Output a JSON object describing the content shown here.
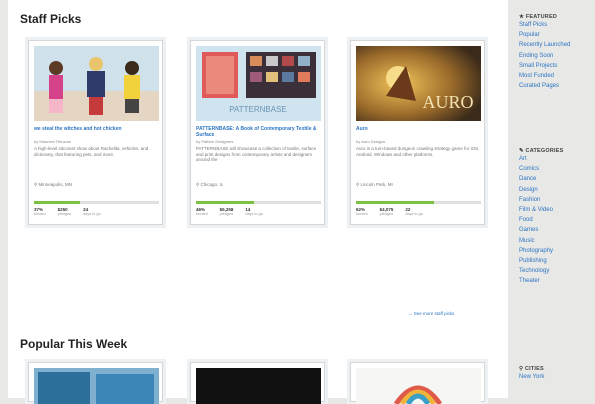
{
  "staff_picks": {
    "heading": "Staff Picks",
    "cards": [
      {
        "title": "we steal the witches and hot chicken",
        "by": "by Maureen Renzoni",
        "blurb": "A high-level sitcomet show about Rachelita, vehicles, and dictionary, that featuring pets, and more.",
        "location": "Minneapolis, MN",
        "funded_pct": 0.37,
        "stats": [
          {
            "v": "37%",
            "l": "funded"
          },
          {
            "v": "$250",
            "l": "pledged"
          },
          {
            "v": "24",
            "l": "days to go"
          }
        ]
      },
      {
        "title": "PATTERNBASE: A Book of Contemporary Textile & Surface",
        "by": "by Pattern Designers",
        "blurb": "PATTERNBASE will showcase a collection of textile, surface and print designs from contemporary artists and designers around the",
        "location": "Chicago, IL",
        "funded_pct": 0.46,
        "stats": [
          {
            "v": "46%",
            "l": "funded"
          },
          {
            "v": "$5,258",
            "l": "pledged"
          },
          {
            "v": "14",
            "l": "days to go"
          }
        ]
      },
      {
        "title": "Auro",
        "by": "by Auro Designs",
        "blurb": "Auro is a turn-based dungeon crawling strategy game for iOS, Android, Windows and other platforms.",
        "location": "Lincoln Park, MI",
        "funded_pct": 0.62,
        "stats": [
          {
            "v": "62%",
            "l": "funded"
          },
          {
            "v": "$4,075",
            "l": "pledged"
          },
          {
            "v": "22",
            "l": "days to go"
          }
        ]
      }
    ],
    "see_more": "→ See more staff picks"
  },
  "popular": {
    "heading": "Popular This Week"
  },
  "sidebar": {
    "featured_heading": "★ FEATURED",
    "featured": [
      "Staff Picks",
      "Popular",
      "Recently Launched",
      "Ending Soon",
      "Small Projects",
      "Most Funded",
      "Curated Pages"
    ],
    "categories_heading": "CATEGORIES",
    "categories": [
      "Art",
      "Comics",
      "Dance",
      "Design",
      "Fashion",
      "Film & Video",
      "Food",
      "Games",
      "Music",
      "Photography",
      "Publishing",
      "Technology",
      "Theater"
    ],
    "cities_heading": "CITIES",
    "cities": [
      "New York"
    ]
  },
  "colors": {
    "link": "#2c75c4",
    "progress": "#7bc142"
  }
}
